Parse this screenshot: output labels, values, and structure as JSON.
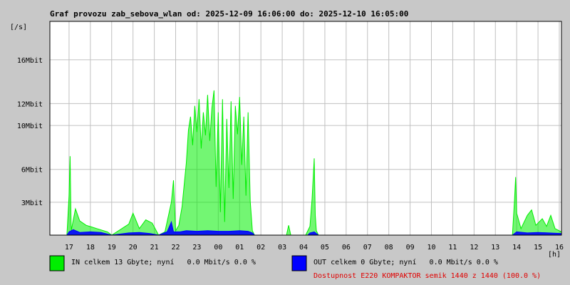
{
  "chart_data": {
    "type": "area",
    "title": "Graf provozu zab_sebova_wlan od: 2025-12-09 16:06:00 do: 2025-12-10 16:05:00",
    "ylabel": "[/s]",
    "xlabel": "[h]",
    "ylim": [
      0,
      19.5
    ],
    "y_ticks": [
      {
        "value": 3,
        "label": "3Mbit"
      },
      {
        "value": 6,
        "label": "6Mbit"
      },
      {
        "value": 10,
        "label": "10Mbit"
      },
      {
        "value": 12,
        "label": "12Mbit"
      },
      {
        "value": 16,
        "label": "16Mbit"
      }
    ],
    "x_unit": "hour of day (continuous, 17 = 17:00 day 1, 40 = 16:00 day 2)",
    "xlim": [
      16.1,
      40.1
    ],
    "x_ticks": [
      {
        "value": 17,
        "label": "17"
      },
      {
        "value": 18,
        "label": "18"
      },
      {
        "value": 19,
        "label": "19"
      },
      {
        "value": 20,
        "label": "20"
      },
      {
        "value": 21,
        "label": "21"
      },
      {
        "value": 22,
        "label": "22"
      },
      {
        "value": 23,
        "label": "23"
      },
      {
        "value": 24,
        "label": "00"
      },
      {
        "value": 25,
        "label": "01"
      },
      {
        "value": 26,
        "label": "02"
      },
      {
        "value": 27,
        "label": "03"
      },
      {
        "value": 28,
        "label": "04"
      },
      {
        "value": 29,
        "label": "05"
      },
      {
        "value": 30,
        "label": "06"
      },
      {
        "value": 31,
        "label": "07"
      },
      {
        "value": 32,
        "label": "08"
      },
      {
        "value": 33,
        "label": "09"
      },
      {
        "value": 34,
        "label": "10"
      },
      {
        "value": 35,
        "label": "11"
      },
      {
        "value": 36,
        "label": "12"
      },
      {
        "value": 37,
        "label": "13"
      },
      {
        "value": 38,
        "label": "14"
      },
      {
        "value": 39,
        "label": "15"
      },
      {
        "value": 40,
        "label": "16"
      }
    ],
    "grid": true,
    "series": [
      {
        "name": "IN",
        "color": "#00ee00",
        "points": [
          [
            16.1,
            0
          ],
          [
            16.9,
            0
          ],
          [
            17.0,
            3.6
          ],
          [
            17.05,
            7.2
          ],
          [
            17.1,
            0.4
          ],
          [
            17.3,
            2.4
          ],
          [
            17.5,
            1.3
          ],
          [
            17.8,
            0.9
          ],
          [
            18.3,
            0.6
          ],
          [
            18.8,
            0.3
          ],
          [
            19.0,
            0
          ],
          [
            19.8,
            1.0
          ],
          [
            20.0,
            2.0
          ],
          [
            20.3,
            0.6
          ],
          [
            20.6,
            1.4
          ],
          [
            20.9,
            1.1
          ],
          [
            21.2,
            0
          ],
          [
            21.5,
            0.3
          ],
          [
            21.8,
            3.0
          ],
          [
            21.9,
            5.0
          ],
          [
            22.0,
            0.4
          ],
          [
            22.15,
            0.9
          ],
          [
            22.3,
            2.6
          ],
          [
            22.5,
            6.6
          ],
          [
            22.6,
            9.6
          ],
          [
            22.7,
            10.8
          ],
          [
            22.8,
            8.2
          ],
          [
            22.9,
            11.8
          ],
          [
            23.0,
            9.4
          ],
          [
            23.1,
            12.4
          ],
          [
            23.2,
            7.9
          ],
          [
            23.3,
            11.2
          ],
          [
            23.4,
            9.1
          ],
          [
            23.5,
            12.8
          ],
          [
            23.6,
            8.6
          ],
          [
            23.7,
            11.6
          ],
          [
            23.8,
            13.2
          ],
          [
            23.9,
            4.4
          ],
          [
            24.0,
            11.2
          ],
          [
            24.1,
            2.1
          ],
          [
            24.2,
            12.4
          ],
          [
            24.3,
            1.2
          ],
          [
            24.4,
            10.6
          ],
          [
            24.5,
            4.3
          ],
          [
            24.6,
            12.2
          ],
          [
            24.7,
            3.3
          ],
          [
            24.8,
            11.8
          ],
          [
            24.9,
            9.2
          ],
          [
            25.0,
            12.6
          ],
          [
            25.1,
            6.4
          ],
          [
            25.2,
            10.8
          ],
          [
            25.3,
            3.6
          ],
          [
            25.4,
            11.2
          ],
          [
            25.5,
            3.1
          ],
          [
            25.6,
            0.4
          ],
          [
            25.7,
            0
          ],
          [
            27.2,
            0
          ],
          [
            27.3,
            0.9
          ],
          [
            27.4,
            0
          ],
          [
            28.1,
            0
          ],
          [
            28.3,
            0.8
          ],
          [
            28.4,
            3.3
          ],
          [
            28.5,
            7.0
          ],
          [
            28.55,
            1.8
          ],
          [
            28.6,
            0.4
          ],
          [
            28.7,
            0
          ],
          [
            37.8,
            0
          ],
          [
            37.9,
            3.3
          ],
          [
            37.95,
            5.3
          ],
          [
            38.0,
            2.0
          ],
          [
            38.2,
            0.6
          ],
          [
            38.5,
            1.8
          ],
          [
            38.7,
            2.3
          ],
          [
            38.9,
            0.9
          ],
          [
            39.2,
            1.5
          ],
          [
            39.4,
            0.8
          ],
          [
            39.6,
            1.8
          ],
          [
            39.8,
            0.6
          ],
          [
            40.1,
            0.3
          ]
        ]
      },
      {
        "name": "OUT",
        "color": "#0000ff",
        "points": [
          [
            16.1,
            0
          ],
          [
            16.9,
            0
          ],
          [
            17.0,
            0.3
          ],
          [
            17.2,
            0.5
          ],
          [
            17.5,
            0.25
          ],
          [
            18.0,
            0.3
          ],
          [
            18.5,
            0.25
          ],
          [
            19.0,
            0
          ],
          [
            19.8,
            0.2
          ],
          [
            20.3,
            0.25
          ],
          [
            20.8,
            0.15
          ],
          [
            21.2,
            0
          ],
          [
            21.6,
            0.3
          ],
          [
            21.8,
            1.2
          ],
          [
            21.9,
            0.3
          ],
          [
            22.2,
            0.3
          ],
          [
            22.5,
            0.4
          ],
          [
            23.0,
            0.35
          ],
          [
            23.5,
            0.4
          ],
          [
            24.0,
            0.35
          ],
          [
            24.5,
            0.35
          ],
          [
            25.0,
            0.4
          ],
          [
            25.4,
            0.35
          ],
          [
            25.6,
            0.2
          ],
          [
            25.7,
            0
          ],
          [
            28.2,
            0
          ],
          [
            28.3,
            0.2
          ],
          [
            28.5,
            0.3
          ],
          [
            28.7,
            0
          ],
          [
            37.8,
            0
          ],
          [
            38.0,
            0.3
          ],
          [
            38.5,
            0.2
          ],
          [
            39.0,
            0.25
          ],
          [
            39.5,
            0.2
          ],
          [
            40.1,
            0.15
          ]
        ]
      }
    ]
  },
  "legend": {
    "in_text": "IN celkem 13 Gbyte; nyní   0.0 Mbit/s 0.0 %",
    "out_text": "OUT celkem 0 Gbyte; nyní   0.0 Mbit/s 0.0 %",
    "availability_text": "Dostupnost E220 KOMPAKTOR semik 1440 z 1440 (100.0 %)",
    "in_color": "#00ee00",
    "out_color": "#0000ff",
    "availability_color": "#e00000"
  }
}
